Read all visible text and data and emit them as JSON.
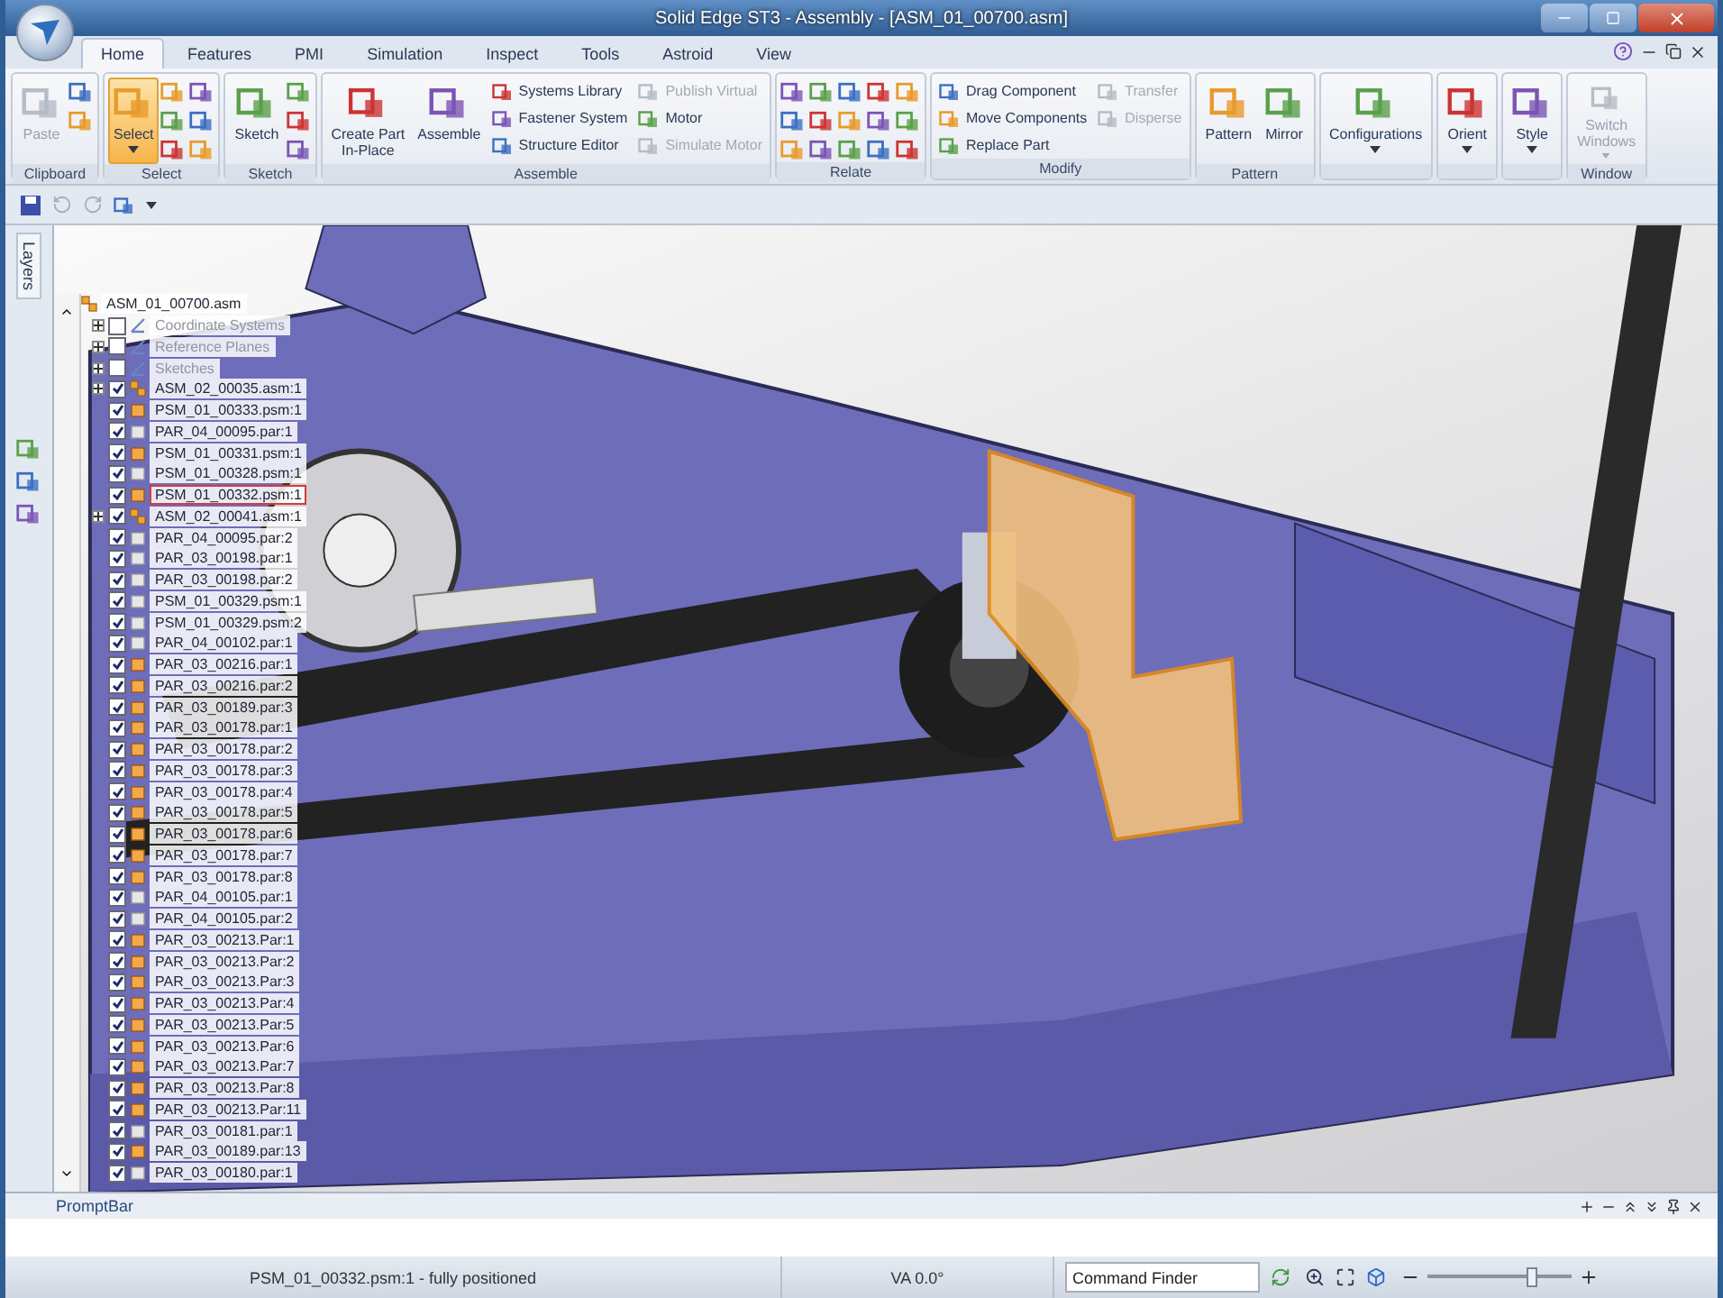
{
  "window": {
    "title": "Solid Edge ST3 - Assembly - [ASM_01_00700.asm]"
  },
  "tabs": [
    {
      "label": "Home",
      "selected": true
    },
    {
      "label": "Features",
      "selected": false
    },
    {
      "label": "PMI",
      "selected": false
    },
    {
      "label": "Simulation",
      "selected": false
    },
    {
      "label": "Inspect",
      "selected": false
    },
    {
      "label": "Tools",
      "selected": false
    },
    {
      "label": "Astroid",
      "selected": false
    },
    {
      "label": "View",
      "selected": false
    }
  ],
  "ribbon": [
    {
      "label": "Clipboard",
      "large": [
        {
          "label": "Paste",
          "disabled": true,
          "dropdown": false,
          "selected": false
        }
      ]
    },
    {
      "label": "Select",
      "large": [
        {
          "label": "Select",
          "disabled": false,
          "dropdown": true,
          "selected": true
        }
      ]
    },
    {
      "label": "Sketch",
      "large": [
        {
          "label": "Sketch",
          "disabled": false,
          "dropdown": false,
          "selected": false
        }
      ]
    },
    {
      "label": "Assemble",
      "large": [
        {
          "label": "Create Part\nIn-Place",
          "disabled": false,
          "dropdown": false,
          "selected": false
        },
        {
          "label": "Assemble",
          "disabled": false,
          "dropdown": false,
          "selected": false
        }
      ],
      "small": [
        {
          "label": "Systems Library",
          "disabled": false
        },
        {
          "label": "Fastener System",
          "disabled": false
        },
        {
          "label": "Structure Editor",
          "disabled": false
        },
        {
          "label": "Publish Virtual",
          "disabled": true
        },
        {
          "label": "Motor",
          "disabled": false
        },
        {
          "label": "Simulate Motor",
          "disabled": true
        }
      ]
    },
    {
      "label": "Relate"
    },
    {
      "label": "Modify",
      "small": [
        {
          "label": "Drag Component",
          "disabled": false
        },
        {
          "label": "Move Components",
          "disabled": false
        },
        {
          "label": "Replace Part",
          "disabled": false
        },
        {
          "label": "Transfer",
          "disabled": true
        },
        {
          "label": "Disperse",
          "disabled": true
        }
      ]
    },
    {
      "label": "Pattern",
      "large": [
        {
          "label": "Pattern",
          "disabled": false,
          "dropdown": false,
          "selected": false
        },
        {
          "label": "Mirror",
          "disabled": false,
          "dropdown": false,
          "selected": false
        }
      ]
    },
    {
      "large": [
        {
          "label": "Configurations",
          "disabled": false,
          "dropdown": true,
          "selected": false
        }
      ]
    },
    {
      "large": [
        {
          "label": "Orient",
          "disabled": false,
          "dropdown": true,
          "selected": false
        }
      ]
    },
    {
      "large": [
        {
          "label": "Style",
          "disabled": false,
          "dropdown": true,
          "selected": false
        }
      ]
    },
    {
      "label": "Window",
      "large": [
        {
          "label": "Switch\nWindows",
          "disabled": true,
          "dropdown": true,
          "selected": false
        }
      ]
    }
  ],
  "side_panel": {
    "label": "Layers"
  },
  "tree": {
    "label": "ASM_01_00700.asm",
    "children": [
      {
        "label": "Coordinate Systems",
        "kind": "folder",
        "checked": false,
        "selected": false
      },
      {
        "label": "Reference Planes",
        "kind": "folder",
        "checked": false,
        "selected": false
      },
      {
        "label": "Sketches",
        "kind": "folder",
        "checked": false,
        "selected": false
      },
      {
        "label": "ASM_02_00035.asm:1",
        "kind": "assembly",
        "checked": true,
        "selected": false
      },
      {
        "label": "PSM_01_00333.psm:1",
        "kind": "part",
        "checked": true,
        "active": true,
        "selected": false
      },
      {
        "label": "PAR_04_00095.par:1",
        "kind": "part",
        "checked": true,
        "active": false,
        "selected": false
      },
      {
        "label": "PSM_01_00331.psm:1",
        "kind": "part",
        "checked": true,
        "active": true,
        "selected": false
      },
      {
        "label": "PSM_01_00328.psm:1",
        "kind": "part",
        "checked": true,
        "active": false,
        "selected": false
      },
      {
        "label": "PSM_01_00332.psm:1",
        "kind": "part",
        "checked": true,
        "active": true,
        "selected": true
      },
      {
        "label": "ASM_02_00041.asm:1",
        "kind": "assembly",
        "checked": true,
        "selected": false
      },
      {
        "label": "PAR_04_00095.par:2",
        "kind": "part",
        "checked": true,
        "active": false,
        "selected": false
      },
      {
        "label": "PAR_03_00198.par:1",
        "kind": "part",
        "checked": true,
        "active": false,
        "selected": false
      },
      {
        "label": "PAR_03_00198.par:2",
        "kind": "part",
        "checked": true,
        "active": false,
        "selected": false
      },
      {
        "label": "PSM_01_00329.psm:1",
        "kind": "part",
        "checked": true,
        "active": false,
        "selected": false
      },
      {
        "label": "PSM_01_00329.psm:2",
        "kind": "part",
        "checked": true,
        "active": false,
        "selected": false
      },
      {
        "label": "PAR_04_00102.par:1",
        "kind": "part",
        "checked": true,
        "active": false,
        "selected": false
      },
      {
        "label": "PAR_03_00216.par:1",
        "kind": "part",
        "checked": true,
        "active": true,
        "selected": false
      },
      {
        "label": "PAR_03_00216.par:2",
        "kind": "part",
        "checked": true,
        "active": true,
        "selected": false
      },
      {
        "label": "PAR_03_00189.par:3",
        "kind": "part",
        "checked": true,
        "active": true,
        "selected": false
      },
      {
        "label": "PAR_03_00178.par:1",
        "kind": "part",
        "checked": true,
        "active": true,
        "selected": false
      },
      {
        "label": "PAR_03_00178.par:2",
        "kind": "part",
        "checked": true,
        "active": true,
        "selected": false
      },
      {
        "label": "PAR_03_00178.par:3",
        "kind": "part",
        "checked": true,
        "active": true,
        "selected": false
      },
      {
        "label": "PAR_03_00178.par:4",
        "kind": "part",
        "checked": true,
        "active": true,
        "selected": false
      },
      {
        "label": "PAR_03_00178.par:5",
        "kind": "part",
        "checked": true,
        "active": true,
        "selected": false
      },
      {
        "label": "PAR_03_00178.par:6",
        "kind": "part",
        "checked": true,
        "active": true,
        "selected": false
      },
      {
        "label": "PAR_03_00178.par:7",
        "kind": "part",
        "checked": true,
        "active": true,
        "selected": false
      },
      {
        "label": "PAR_03_00178.par:8",
        "kind": "part",
        "checked": true,
        "active": true,
        "selected": false
      },
      {
        "label": "PAR_04_00105.par:1",
        "kind": "part",
        "checked": true,
        "active": false,
        "selected": false
      },
      {
        "label": "PAR_04_00105.par:2",
        "kind": "part",
        "checked": true,
        "active": false,
        "selected": false
      },
      {
        "label": "PAR_03_00213.Par:1",
        "kind": "part",
        "checked": true,
        "active": true,
        "selected": false
      },
      {
        "label": "PAR_03_00213.Par:2",
        "kind": "part",
        "checked": true,
        "active": true,
        "selected": false
      },
      {
        "label": "PAR_03_00213.Par:3",
        "kind": "part",
        "checked": true,
        "active": true,
        "selected": false
      },
      {
        "label": "PAR_03_00213.Par:4",
        "kind": "part",
        "checked": true,
        "active": true,
        "selected": false
      },
      {
        "label": "PAR_03_00213.Par:5",
        "kind": "part",
        "checked": true,
        "active": true,
        "selected": false
      },
      {
        "label": "PAR_03_00213.Par:6",
        "kind": "part",
        "checked": true,
        "active": true,
        "selected": false
      },
      {
        "label": "PAR_03_00213.Par:7",
        "kind": "part",
        "checked": true,
        "active": true,
        "selected": false
      },
      {
        "label": "PAR_03_00213.Par:8",
        "kind": "part",
        "checked": true,
        "active": true,
        "selected": false
      },
      {
        "label": "PAR_03_00213.Par:11",
        "kind": "part",
        "checked": true,
        "active": true,
        "selected": false
      },
      {
        "label": "PAR_03_00181.par:1",
        "kind": "part",
        "checked": true,
        "active": false,
        "selected": false
      },
      {
        "label": "PAR_03_00189.par:13",
        "kind": "part",
        "checked": true,
        "active": true,
        "selected": false
      },
      {
        "label": "PAR_03_00180.par:1",
        "kind": "part",
        "checked": true,
        "active": false,
        "selected": false
      }
    ]
  },
  "prompt_bar": {
    "title": "PromptBar"
  },
  "status_bar": {
    "message": "PSM_01_00332.psm:1 - fully positioned",
    "view_angle": "VA 0.0°",
    "command_finder": {
      "placeholder": "Command Finder"
    },
    "zoom": {
      "level": 0.72
    }
  }
}
